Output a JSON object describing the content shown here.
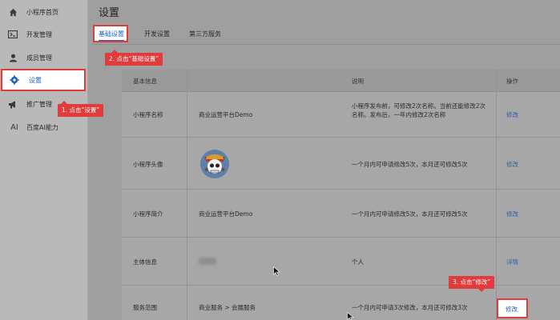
{
  "sidebar": {
    "items": [
      {
        "label": "小程序首页",
        "icon": "home-icon"
      },
      {
        "label": "开发管理",
        "icon": "code-icon"
      },
      {
        "label": "成员管理",
        "icon": "user-icon"
      },
      {
        "label": "设置",
        "icon": "gear-icon"
      },
      {
        "label": "推广管理",
        "icon": "megaphone-icon"
      },
      {
        "label": "百度AI能力",
        "icon": "ai-icon"
      }
    ],
    "ai_glyph": "AI"
  },
  "header": {
    "title": "设置"
  },
  "tabs": [
    {
      "label": "基础设置"
    },
    {
      "label": "开发设置"
    },
    {
      "label": "第三方服务"
    }
  ],
  "table": {
    "columns": {
      "info": "基本信息",
      "desc": "说明",
      "action": "操作"
    },
    "rows": [
      {
        "name": "小程序名称",
        "value": "商业运营平台Demo",
        "desc": "小程序发布前，可修改2次名称。当前还能修改2次名称。发布后，一年内修改2次名称",
        "action": "修改"
      },
      {
        "name": "小程序头像",
        "value": "",
        "desc": "一个月内可申请修改5次，本月还可修改5次",
        "action": "修改"
      },
      {
        "name": "小程序简介",
        "value": "商业运营平台Demo",
        "desc": "一个月内可申请修改5次，本月还可修改5次",
        "action": "修改"
      },
      {
        "name": "主体信息",
        "value": "",
        "desc": "个人",
        "action": "详情"
      },
      {
        "name": "服务范围",
        "value": "商业服务 > 会展服务",
        "desc": "一个月内可申请3次修改，本月还可修改3次",
        "action": "修改"
      }
    ]
  },
  "callouts": {
    "step1": "1. 点击“设置”",
    "step2": "2. 点击“基础设置”",
    "step3": "3. 点击“修改”"
  },
  "colors": {
    "highlight": "#e23b3b",
    "link": "#1e63c8"
  }
}
